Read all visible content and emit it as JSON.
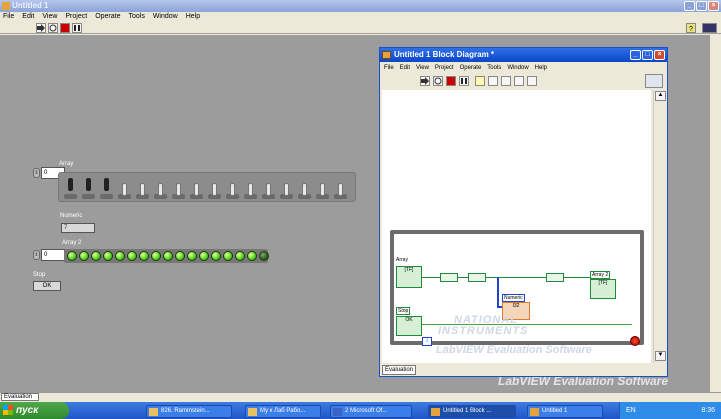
{
  "front_panel": {
    "title": "Untitled 1",
    "menu": [
      "File",
      "Edit",
      "View",
      "Project",
      "Operate",
      "Tools",
      "Window",
      "Help"
    ],
    "array_label": "Array",
    "array_index": "0",
    "array_switch_states": [
      true,
      true,
      true,
      false,
      false,
      false,
      false,
      false,
      false,
      false,
      false,
      false,
      false,
      false,
      false,
      false
    ],
    "numeric_label": "Numeric",
    "numeric_value": "7",
    "array2_label": "Array 2",
    "array2_index": "0",
    "array2_led_states": [
      true,
      true,
      true,
      true,
      true,
      true,
      true,
      true,
      true,
      true,
      true,
      true,
      true,
      true,
      true,
      true,
      false
    ],
    "stop_label": "Stop",
    "stop_button": "OK",
    "status_tab": "Evaluation",
    "watermark": "LabVIEW  Evaluation Software"
  },
  "block_diagram": {
    "title": "Untitled 1 Block Diagram *",
    "menu": [
      "File",
      "Edit",
      "View",
      "Project",
      "Operate",
      "Tools",
      "Window",
      "Help"
    ],
    "array_terminal": "Array",
    "array2_terminal": "Array 2",
    "numeric_terminal": "Numeric",
    "stop_terminal": "Stop",
    "stop_value": "OK",
    "array_type": "[TF]",
    "array2_type": "[TF]",
    "numeric_type": "I32",
    "iteration": "i",
    "logo_line1": "NATIONAL",
    "logo_line2": "INSTRUMENTS",
    "watermark": "LabVIEW  Evaluation Software",
    "status_tab": "Evaluation"
  },
  "taskbar": {
    "start": "пуск",
    "tasks": [
      "826. Rammstein...",
      "Му к Лаб Рабо...",
      "2 Microsoft Of...",
      "Untitled 1 Block ...",
      "Untitled 1"
    ],
    "lang": "EN",
    "clock": "8:36"
  },
  "colors": {
    "panel_bg": "#9c9c9c",
    "titlebar_active": "#0a46c6",
    "taskbar": "#1f55c7",
    "led_on": "#4fd01e",
    "wire_bool": "#1f8a3a",
    "wire_int": "#2244cc"
  }
}
